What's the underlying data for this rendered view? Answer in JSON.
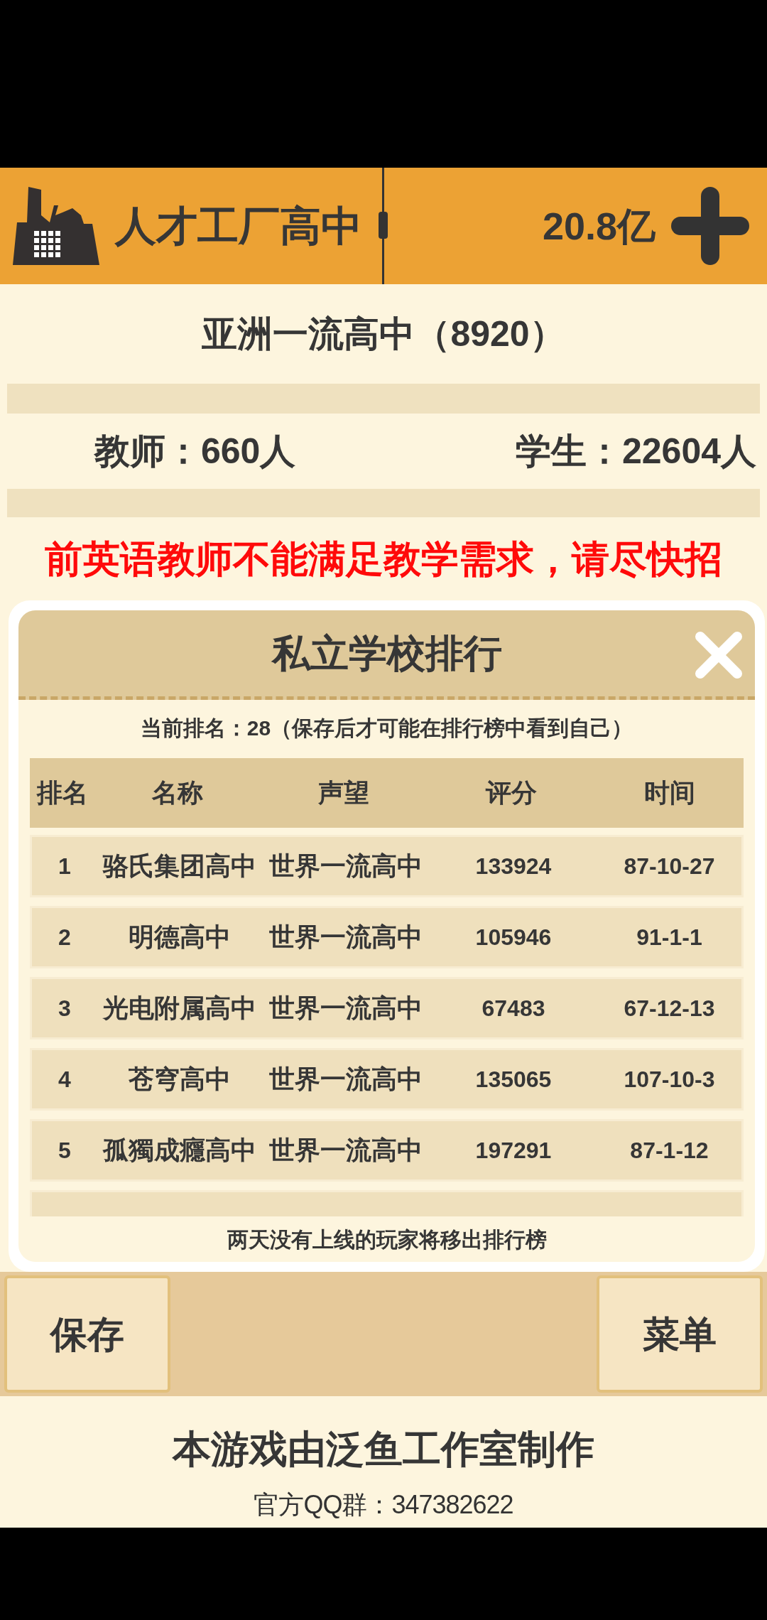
{
  "top_bar": {
    "school_name": "人才工厂高中",
    "money": "20.8亿"
  },
  "school_info": {
    "level_title": "亚洲一流高中（8920）",
    "stats": [
      "教师：660人",
      "学生：22604人"
    ],
    "notice": "前英语教师不能满足教学需求，请尽快招"
  },
  "ranking_dialog": {
    "title": "私立学校排行",
    "current_rank": "当前排名：28（保存后才可能在排行榜中看到自己）",
    "columns": [
      "排名",
      "名称",
      "声望",
      "评分",
      "时间"
    ],
    "rows": [
      {
        "rank": "1",
        "name": "骆氏集团高中",
        "prestige": "世界一流高中",
        "score": "133924",
        "time": "87-10-27"
      },
      {
        "rank": "2",
        "name": "明德高中",
        "prestige": "世界一流高中",
        "score": "105946",
        "time": "91-1-1"
      },
      {
        "rank": "3",
        "name": "光电附属高中",
        "prestige": "世界一流高中",
        "score": "67483",
        "time": "67-12-13"
      },
      {
        "rank": "4",
        "name": "苍穹高中",
        "prestige": "世界一流高中",
        "score": "135065",
        "time": "107-10-3"
      },
      {
        "rank": "5",
        "name": "孤獨成癮高中",
        "prestige": "世界一流高中",
        "score": "197291",
        "time": "87-1-12"
      }
    ],
    "footer_note": "两天没有上线的玩家将移出排行榜"
  },
  "buttons": [
    "保存",
    "菜单"
  ],
  "credits": {
    "studio": "本游戏由泛鱼工作室制作",
    "qq_group": "官方QQ群：347382622"
  }
}
